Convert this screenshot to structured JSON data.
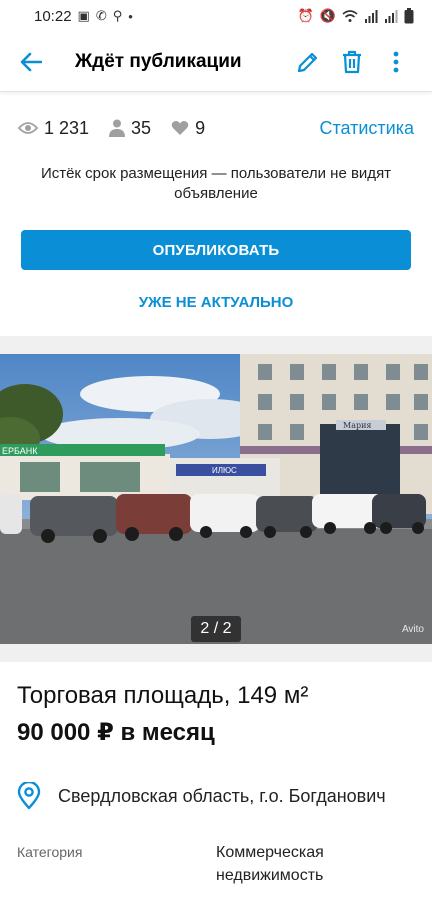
{
  "status_bar": {
    "time": "10:22",
    "left_icons": [
      "gallery-icon",
      "viber-icon",
      "search-icon",
      "dot-icon"
    ],
    "right_icons": [
      "alarm-icon",
      "mute-icon",
      "wifi-icon",
      "signal-icon",
      "signal-icon",
      "battery-icon"
    ]
  },
  "app_bar": {
    "title": "Ждёт публикации",
    "accent": "#0a8fd6"
  },
  "stats": {
    "views": "1 231",
    "contacts": "35",
    "favorites": "9",
    "link": "Статистика"
  },
  "notice": {
    "text": "Истёк срок размещения — пользователи не видят объявление"
  },
  "actions": {
    "publish": "ОПУБЛИКОВАТЬ",
    "not_actual": "УЖЕ НЕ АКТУАЛЬНО"
  },
  "gallery": {
    "counter": "2 / 2",
    "watermark": "Avito",
    "sign_bank": "ЕРБАНК",
    "sign_shop": "ИЛЮС",
    "sign_mall": "Мария"
  },
  "listing": {
    "title": "Торговая площадь, 149 м²",
    "price": "90 000 ₽ в месяц",
    "location": "Свердловская область, г.о. Богданович"
  },
  "params": [
    {
      "label": "Категория",
      "value_line1": "Коммерческая",
      "value_line2": "недвижимость"
    }
  ]
}
